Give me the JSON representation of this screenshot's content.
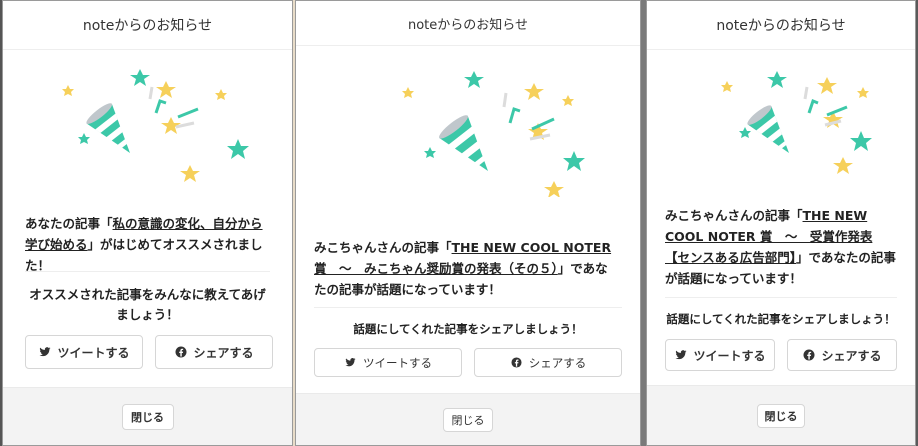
{
  "colors": {
    "accent": "#3cc8a8",
    "star_yellow": "#f6d05a",
    "star_teal": "#3cc8a8",
    "confetti_gray": "#dcdcdc",
    "footer_bg": "#f3f3f3"
  },
  "modals": [
    {
      "title": "noteからのお知らせ",
      "message": {
        "pre": "あなたの記事「",
        "link": "私の意識の変化、自分から学び始める",
        "post": "」がはじめてオススメされました！"
      },
      "share_text": "オススメされた記事をみんなに教えてあげましょう！",
      "tweet_label": "ツイートする",
      "share_label": "シェアする",
      "close_label": "閉じる"
    },
    {
      "title": "noteからのお知らせ",
      "message": {
        "author": "みこちゃんさん",
        "mid": "の記事「",
        "link": "THE NEW COOL NOTER 賞　～　みこちゃん奨励賞の発表（その５）",
        "post": "」であなたの記事が話題になっています！"
      },
      "share_text": "話題にしてくれた記事をシェアしましょう！",
      "tweet_label": "ツイートする",
      "share_label": "シェアする",
      "close_label": "閉じる"
    },
    {
      "title": "noteからのお知らせ",
      "message": {
        "author": "みこちゃんさん",
        "mid": "の記事「",
        "link": "THE NEW COOL NOTER 賞　～　受賞作発表【センスある広告部門】",
        "post": "」であなたの記事が話題になっています！"
      },
      "share_text": "話題にしてくれた記事をシェアしましょう！",
      "tweet_label": "ツイートする",
      "share_label": "シェアする",
      "close_label": "閉じる"
    }
  ]
}
